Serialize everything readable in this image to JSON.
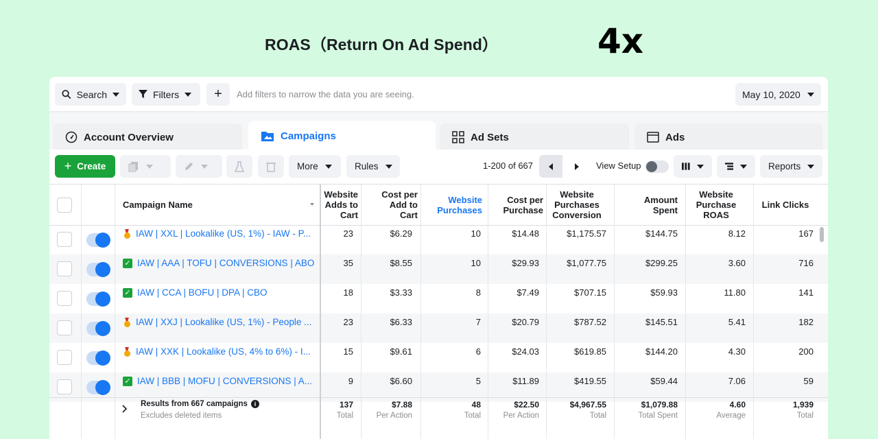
{
  "headline": {
    "label": "ROAS（Return On Ad Spend）",
    "value": "4x"
  },
  "filterbar": {
    "search_label": "Search",
    "filters_label": "Filters",
    "add_symbol": "+",
    "hint": "Add filters to narrow the data you are seeing.",
    "date": "May 10, 2020"
  },
  "tabs": [
    {
      "label": "Account Overview",
      "icon": "gauge-icon",
      "active": false
    },
    {
      "label": "Campaigns",
      "icon": "folder-icon",
      "active": true
    },
    {
      "label": "Ad Sets",
      "icon": "grid-icon",
      "active": false
    },
    {
      "label": "Ads",
      "icon": "ad-icon",
      "active": false
    }
  ],
  "toolbar": {
    "create_label": "Create",
    "more_label": "More",
    "rules_label": "Rules",
    "pager": "1-200 of 667",
    "view_setup": "View Setup",
    "reports_label": "Reports"
  },
  "columns": {
    "campaign_name": "Campaign Name",
    "adds_to_cart": "Website\nAdds to\nCart",
    "cost_per_add": "Cost per\nAdd to\nCart",
    "purchases": "Website\nPurchases",
    "cost_per_purchase": "Cost per\nPurchase",
    "purchase_conv": "Website\nPurchases\nConversion",
    "amount_spent": "Amount\nSpent",
    "purchase_roas": "Website\nPurchase\nROAS",
    "link_clicks": "Link Clicks"
  },
  "rows": [
    {
      "icon": "medal",
      "name": "IAW | XXL | Lookalike (US, 1%) - IAW - P...",
      "adds": "23",
      "cpa": "$6.29",
      "purch": "10",
      "cpp": "$14.48",
      "conv": "$1,175.57",
      "spent": "$144.75",
      "roas": "8.12",
      "clicks": "167"
    },
    {
      "icon": "check",
      "name": "IAW | AAA | TOFU | CONVERSIONS | ABO",
      "adds": "35",
      "cpa": "$8.55",
      "purch": "10",
      "cpp": "$29.93",
      "conv": "$1,077.75",
      "spent": "$299.25",
      "roas": "3.60",
      "clicks": "716"
    },
    {
      "icon": "check",
      "name": "IAW | CCA | BOFU | DPA | CBO",
      "adds": "18",
      "cpa": "$3.33",
      "purch": "8",
      "cpp": "$7.49",
      "conv": "$707.15",
      "spent": "$59.93",
      "roas": "11.80",
      "clicks": "141"
    },
    {
      "icon": "medal",
      "name": "IAW | XXJ | Lookalike (US, 1%) - People ...",
      "adds": "23",
      "cpa": "$6.33",
      "purch": "7",
      "cpp": "$20.79",
      "conv": "$787.52",
      "spent": "$145.51",
      "roas": "5.41",
      "clicks": "182"
    },
    {
      "icon": "medal",
      "name": "IAW | XXK | Lookalike (US, 4% to 6%) - I...",
      "adds": "15",
      "cpa": "$9.61",
      "purch": "6",
      "cpp": "$24.03",
      "conv": "$619.85",
      "spent": "$144.20",
      "roas": "4.30",
      "clicks": "200"
    },
    {
      "icon": "check",
      "name": "IAW | BBB | MOFU | CONVERSIONS | A...",
      "adds": "9",
      "cpa": "$6.60",
      "purch": "5",
      "cpp": "$11.89",
      "conv": "$419.55",
      "spent": "$59.44",
      "roas": "7.06",
      "clicks": "59"
    }
  ],
  "totals": {
    "title": "Results from 667 campaigns",
    "subtitle": "Excludes deleted items",
    "adds": "137",
    "adds_sub": "Total",
    "cpa": "$7.88",
    "cpa_sub": "Per Action",
    "purch": "48",
    "purch_sub": "Total",
    "cpp": "$22.50",
    "cpp_sub": "Per Action",
    "conv": "$4,967.55",
    "conv_sub": "Total",
    "spent": "$1,079.88",
    "spent_sub": "Total Spent",
    "roas": "4.60",
    "roas_sub": "Average",
    "clicks": "1,939",
    "clicks_sub": "Total"
  },
  "colors": {
    "accent": "#1877f2",
    "create": "#1aa33a",
    "background": "#d4fae1"
  }
}
